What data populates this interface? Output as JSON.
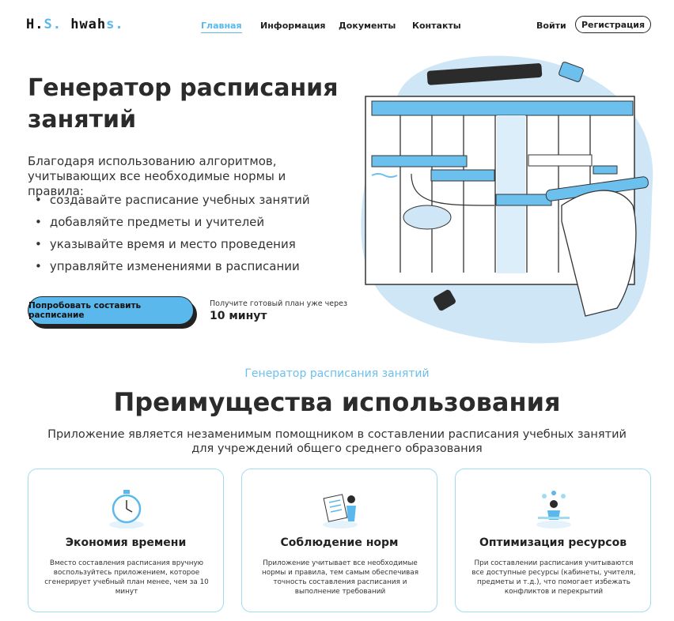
{
  "header": {
    "logo": {
      "part1": "H.",
      "part2": "S.",
      "part3": " hwah",
      "part4": "s."
    },
    "nav": [
      "Главная",
      "Информация",
      "Документы",
      "Контакты"
    ],
    "login": "Войти",
    "register": "Регистрация"
  },
  "hero": {
    "title": "Генератор расписания занятий",
    "lead": "Благодаря использованию алгоритмов, учитывающих все необходимые нормы и правила:",
    "bullets": [
      "создавайте расписание учебных занятий",
      "добавляйте предметы и учителей",
      "указывайте время и место проведения",
      "управляйте изменениями в расписании"
    ],
    "cta": "Попробовать составить расписание",
    "cta_note": "Получите готовый план уже через",
    "cta_big": "10 минут"
  },
  "benefits": {
    "kicker": "Генератор расписания занятий",
    "title": "Преимущества использования",
    "subtitle": "Приложение является незаменимым помощником в составлении расписания учебных занятий для учреждений общего среднего образования",
    "cards": [
      {
        "title": "Экономия времени",
        "text": "Вместо составления расписания вручную воспользуйтесь приложением, которое сгенерирует учебный план менее, чем за 10 минут",
        "icon": "stopwatch-icon"
      },
      {
        "title": "Соблюдение норм",
        "text": "Приложение учитывает все необходимые нормы и правила, тем самым обеспечивая точность составления расписания и выполнение требований",
        "icon": "person-document-icon"
      },
      {
        "title": "Оптимизация ресурсов",
        "text": "При составлении расписания учитываются все доступные ресурсы (кабинеты, учителя, предметы и т.д.), что помогает избежать конфликтов и перекрытий",
        "icon": "person-desk-icon"
      }
    ]
  },
  "colors": {
    "accent": "#5bb8ec",
    "card_border": "#9fdcf2",
    "text": "#2b2b2b"
  }
}
